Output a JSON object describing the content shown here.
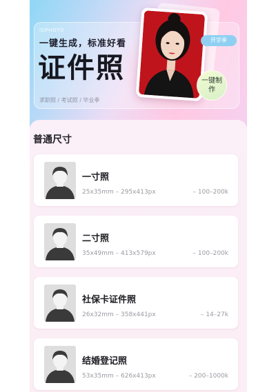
{
  "banner": {
    "brand": "IDPHOTO",
    "tagline": "一键生成，标准好看",
    "title": "证件照",
    "footnote": "求职照 / 考试照 / 毕业季",
    "season_tag": "开学季",
    "make_button": "一键制作"
  },
  "section_title": "普通尺寸",
  "specs": [
    {
      "name": "一寸照",
      "dims": "25x35mm – 295x413px",
      "size": "– 100–200k"
    },
    {
      "name": "二寸照",
      "dims": "35x49mm – 413x579px",
      "size": "– 100–200k"
    },
    {
      "name": "社保卡证件照",
      "dims": "26x32mm – 358x441px",
      "size": "– 14–27k"
    },
    {
      "name": "结婚登记照",
      "dims": "53x35mm – 626x413px",
      "size": "– 200–1000k"
    }
  ],
  "colors": {
    "photo_background": "#c0141c",
    "season_tag": "#8fd0f2",
    "avatar_silhouette": "#3a3a3a"
  }
}
